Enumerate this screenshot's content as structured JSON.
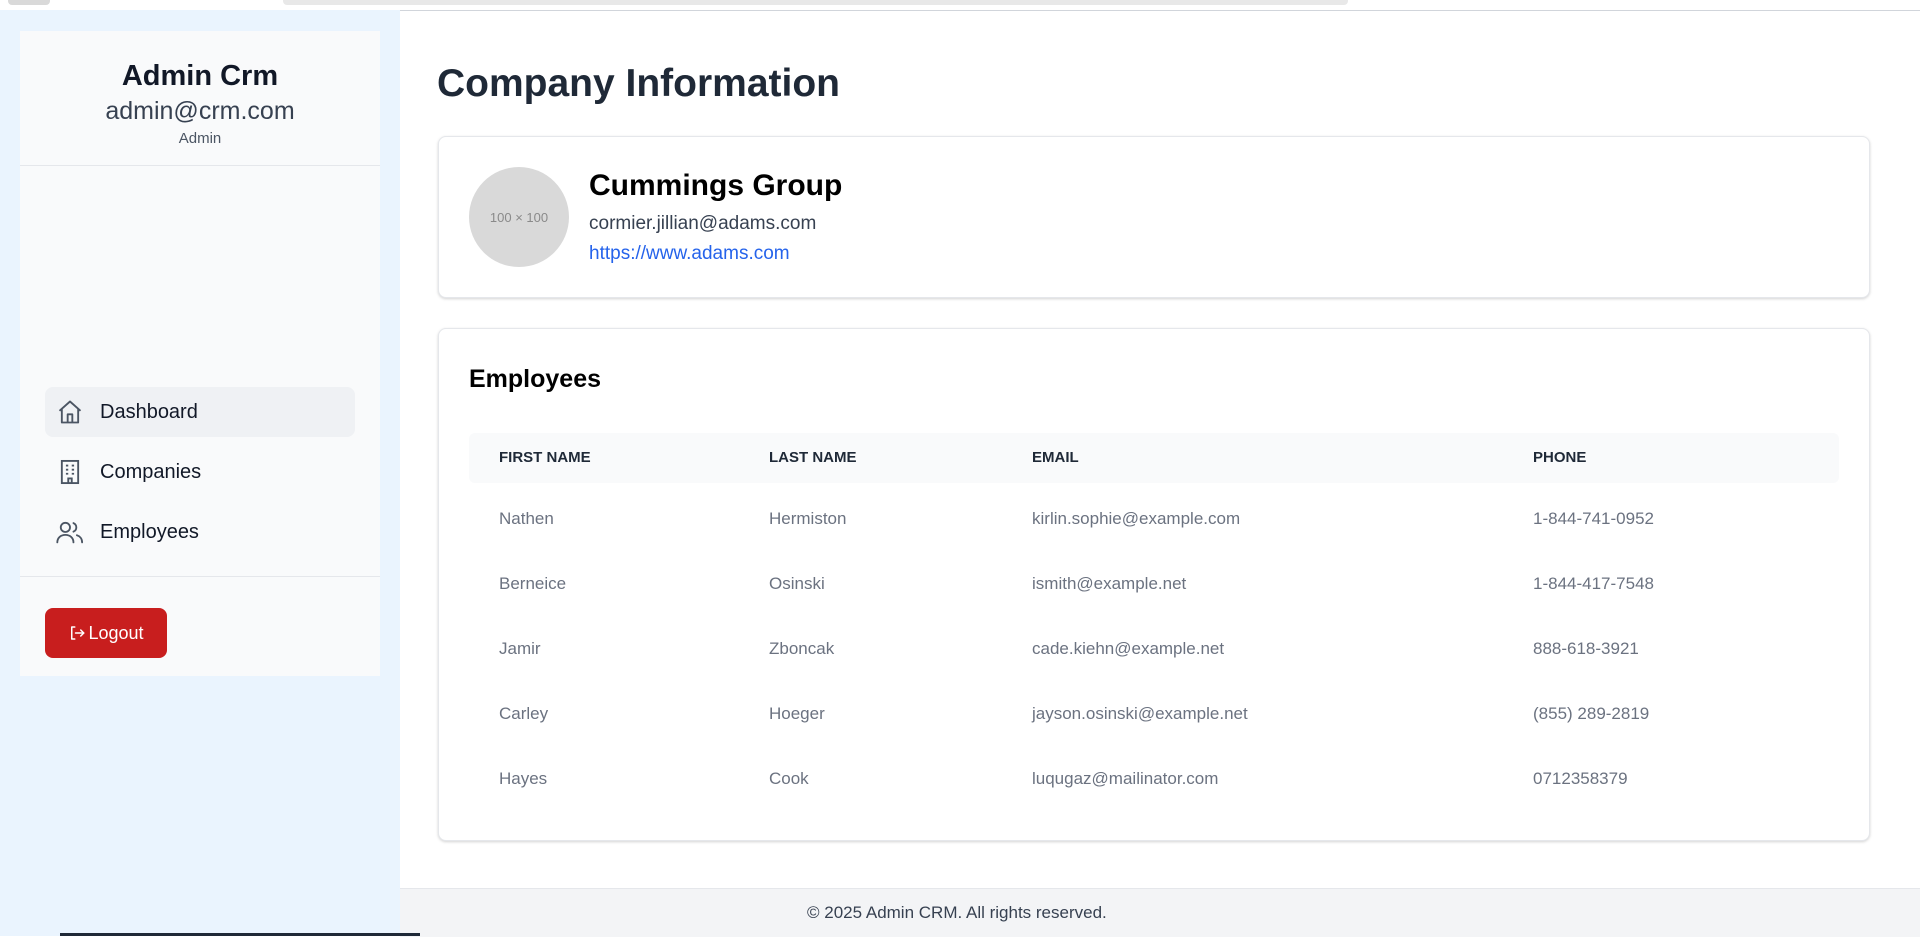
{
  "sidebar": {
    "user_name": "Admin Crm",
    "user_email": "admin@crm.com",
    "user_role": "Admin",
    "nav": [
      {
        "label": "Dashboard",
        "icon": "home-icon"
      },
      {
        "label": "Companies",
        "icon": "building-icon"
      },
      {
        "label": "Employees",
        "icon": "users-icon"
      }
    ],
    "logout_label": "Logout"
  },
  "main": {
    "title": "Company Information",
    "company": {
      "logo_placeholder": "100 × 100",
      "name": "Cummings Group",
      "email": "cormier.jillian@adams.com",
      "website": "https://www.adams.com"
    },
    "employees": {
      "title": "Employees",
      "columns": [
        "FIRST NAME",
        "LAST NAME",
        "EMAIL",
        "PHONE"
      ],
      "rows": [
        [
          "Nathen",
          "Hermiston",
          "kirlin.sophie@example.com",
          "1-844-741-0952"
        ],
        [
          "Berneice",
          "Osinski",
          "ismith@example.net",
          "1-844-417-7548"
        ],
        [
          "Jamir",
          "Zboncak",
          "cade.kiehn@example.net",
          "888-618-3921"
        ],
        [
          "Carley",
          "Hoeger",
          "jayson.osinski@example.net",
          "(855) 289-2819"
        ],
        [
          "Hayes",
          "Cook",
          "luqugaz@mailinator.com",
          "0712358379"
        ]
      ]
    }
  },
  "footer": {
    "text": "© 2025 Admin CRM. All rights reserved."
  },
  "colors": {
    "accent_red": "#c81e1e",
    "link_blue": "#2563eb",
    "sidebar_bg": "#eaf4fe"
  }
}
